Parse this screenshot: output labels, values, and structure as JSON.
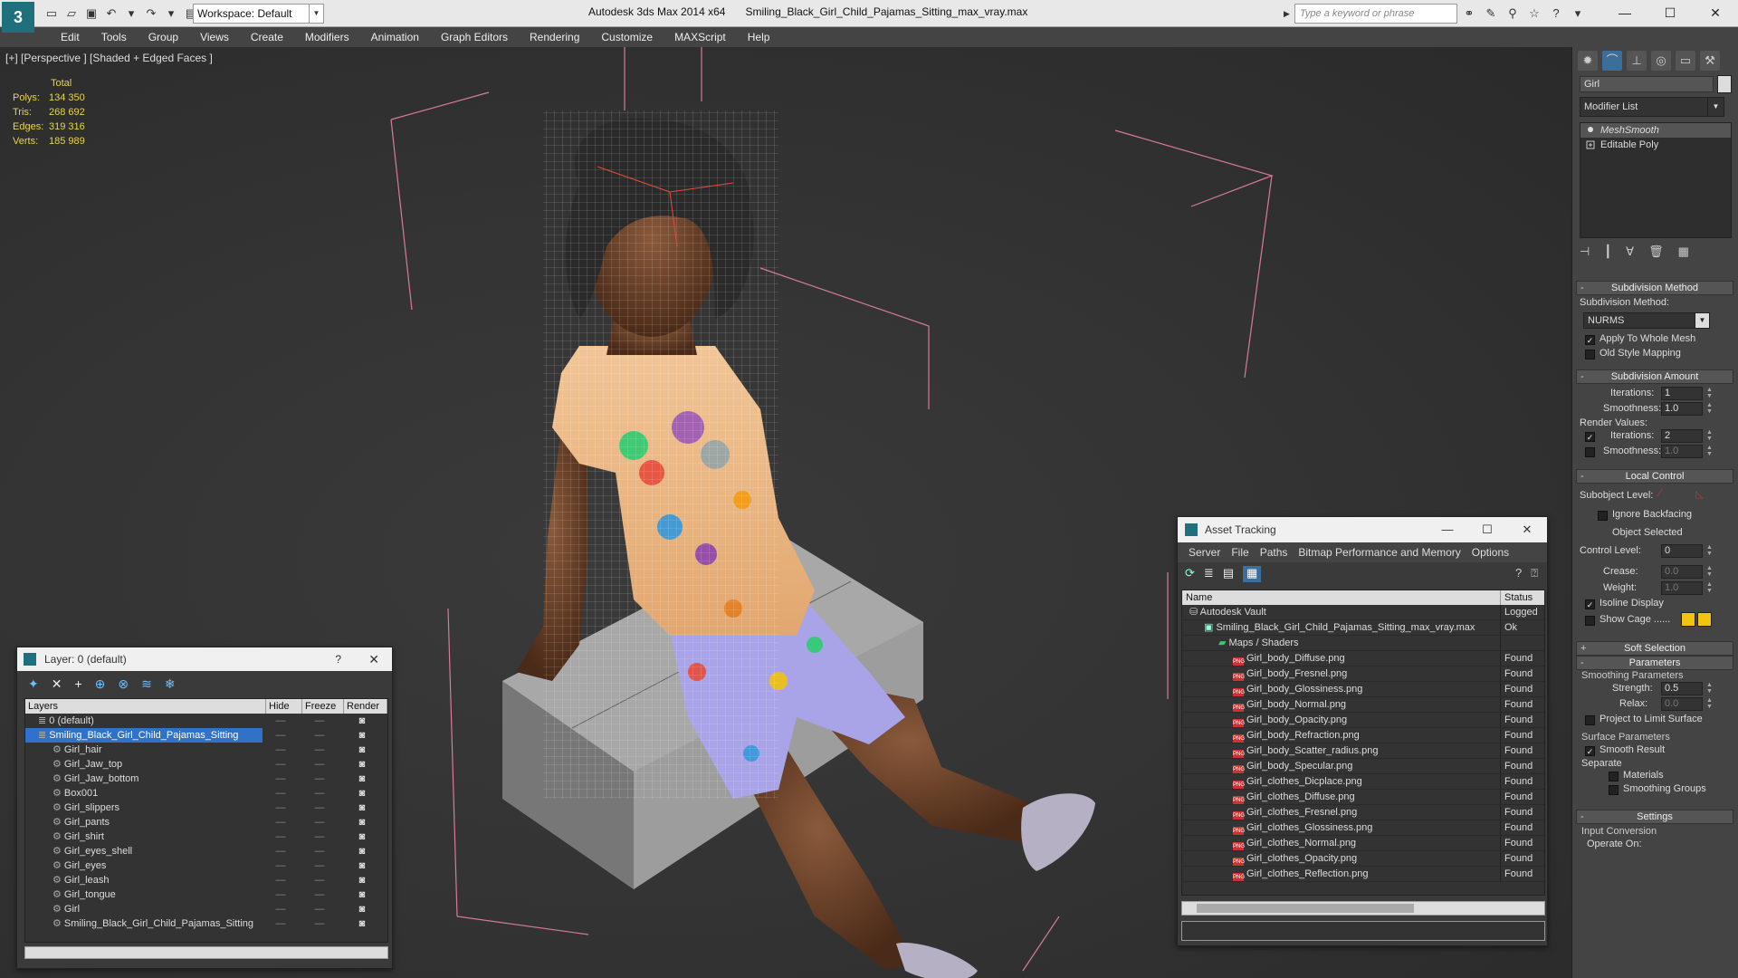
{
  "titlebar": {
    "workspace": "Workspace: Default",
    "app_name": "Autodesk 3ds Max  2014 x64",
    "file_name": "Smiling_Black_Girl_Child_Pajamas_Sitting_max_vray.max",
    "search_placeholder": "Type a keyword or phrase"
  },
  "menu": [
    "Edit",
    "Tools",
    "Group",
    "Views",
    "Create",
    "Modifiers",
    "Animation",
    "Graph Editors",
    "Rendering",
    "Customize",
    "MAXScript",
    "Help"
  ],
  "viewport": {
    "label": "[+] [Perspective ] [Shaded + Edged Faces ]",
    "stats_header": "Total",
    "stats": [
      {
        "label": "Polys:",
        "value": "134 350"
      },
      {
        "label": "Tris:",
        "value": "268 692"
      },
      {
        "label": "Edges:",
        "value": "319 316"
      },
      {
        "label": "Verts:",
        "value": "185 989"
      }
    ]
  },
  "command_panel": {
    "object_name": "Girl",
    "modifier_list": "Modifier List",
    "stack": [
      "MeshSmooth",
      "Editable Poly"
    ],
    "rollouts": {
      "subdiv_method": "Subdivision Method",
      "subdiv_method_label": "Subdivision Method:",
      "subdiv_method_value": "NURMS",
      "apply_whole": "Apply To Whole Mesh",
      "old_style": "Old Style Mapping",
      "subdiv_amount": "Subdivision Amount",
      "iterations_label": "Iterations:",
      "iterations_value": "1",
      "smoothness_label": "Smoothness:",
      "smoothness_value": "1.0",
      "render_values": "Render Values:",
      "r_iterations_label": "Iterations:",
      "r_iterations_value": "2",
      "r_smoothness_label": "Smoothness:",
      "r_smoothness_value": "1.0",
      "local_control": "Local Control",
      "subobject_level": "Subobject Level:",
      "ignore_backfacing": "Ignore Backfacing",
      "object_selected": "Object Selected",
      "control_level": "Control Level:",
      "control_level_value": "0",
      "crease": "Crease:",
      "crease_value": "0.0",
      "weight": "Weight:",
      "weight_value": "1.0",
      "isoline": "Isoline Display",
      "show_cage": "Show Cage ......",
      "soft_selection": "Soft Selection",
      "parameters": "Parameters",
      "smoothing_params": "Smoothing Parameters",
      "strength": "Strength:",
      "strength_value": "0.5",
      "relax": "Relax:",
      "relax_value": "0.0",
      "project_limit": "Project to Limit Surface",
      "surface_params": "Surface Parameters",
      "smooth_result": "Smooth Result",
      "separate": "Separate",
      "materials": "Materials",
      "smoothing_groups": "Smoothing Groups",
      "settings": "Settings",
      "input_conversion": "Input Conversion",
      "operate_on": "Operate On:"
    },
    "colors": {
      "cage": "#f1c40f"
    }
  },
  "layer_window": {
    "title": "Layer: 0 (default)",
    "help": "?",
    "columns": [
      "Layers",
      "Hide",
      "Freeze",
      "Render"
    ],
    "rows": [
      {
        "name": "0 (default)",
        "level": 0
      },
      {
        "name": "Smiling_Black_Girl_Child_Pajamas_Sitting",
        "level": 0,
        "selected": true
      },
      {
        "name": "Girl_hair",
        "level": 1
      },
      {
        "name": "Girl_Jaw_top",
        "level": 1
      },
      {
        "name": "Girl_Jaw_bottom",
        "level": 1
      },
      {
        "name": "Box001",
        "level": 1
      },
      {
        "name": "Girl_slippers",
        "level": 1
      },
      {
        "name": "Girl_pants",
        "level": 1
      },
      {
        "name": "Girl_shirt",
        "level": 1
      },
      {
        "name": "Girl_eyes_shell",
        "level": 1
      },
      {
        "name": "Girl_eyes",
        "level": 1
      },
      {
        "name": "Girl_leash",
        "level": 1
      },
      {
        "name": "Girl_tongue",
        "level": 1
      },
      {
        "name": "Girl",
        "level": 1
      },
      {
        "name": "Smiling_Black_Girl_Child_Pajamas_Sitting",
        "level": 1
      }
    ]
  },
  "asset_tracking": {
    "title": "Asset Tracking",
    "menu": [
      "Server",
      "File",
      "Paths",
      "Bitmap Performance and Memory",
      "Options"
    ],
    "columns": [
      "Name",
      "Status"
    ],
    "rows": [
      {
        "name": "Autodesk Vault",
        "status": "Logged",
        "level": 0,
        "type": "vault"
      },
      {
        "name": "Smiling_Black_Girl_Child_Pajamas_Sitting_max_vray.max",
        "status": "Ok",
        "level": 1,
        "type": "max"
      },
      {
        "name": "Maps / Shaders",
        "status": "",
        "level": 2,
        "type": "folder"
      },
      {
        "name": "Girl_body_Diffuse.png",
        "status": "Found",
        "level": 3,
        "type": "png"
      },
      {
        "name": "Girl_body_Fresnel.png",
        "status": "Found",
        "level": 3,
        "type": "png"
      },
      {
        "name": "Girl_body_Glossiness.png",
        "status": "Found",
        "level": 3,
        "type": "png"
      },
      {
        "name": "Girl_body_Normal.png",
        "status": "Found",
        "level": 3,
        "type": "png"
      },
      {
        "name": "Girl_body_Opacity.png",
        "status": "Found",
        "level": 3,
        "type": "png"
      },
      {
        "name": "Girl_body_Refraction.png",
        "status": "Found",
        "level": 3,
        "type": "png"
      },
      {
        "name": "Girl_body_Scatter_radius.png",
        "status": "Found",
        "level": 3,
        "type": "png"
      },
      {
        "name": "Girl_body_Specular.png",
        "status": "Found",
        "level": 3,
        "type": "png"
      },
      {
        "name": "Girl_clothes_Dicplace.png",
        "status": "Found",
        "level": 3,
        "type": "png"
      },
      {
        "name": "Girl_clothes_Diffuse.png",
        "status": "Found",
        "level": 3,
        "type": "png"
      },
      {
        "name": "Girl_clothes_Fresnel.png",
        "status": "Found",
        "level": 3,
        "type": "png"
      },
      {
        "name": "Girl_clothes_Glossiness.png",
        "status": "Found",
        "level": 3,
        "type": "png"
      },
      {
        "name": "Girl_clothes_Normal.png",
        "status": "Found",
        "level": 3,
        "type": "png"
      },
      {
        "name": "Girl_clothes_Opacity.png",
        "status": "Found",
        "level": 3,
        "type": "png"
      },
      {
        "name": "Girl_clothes_Reflection.png",
        "status": "Found",
        "level": 3,
        "type": "png"
      }
    ]
  }
}
